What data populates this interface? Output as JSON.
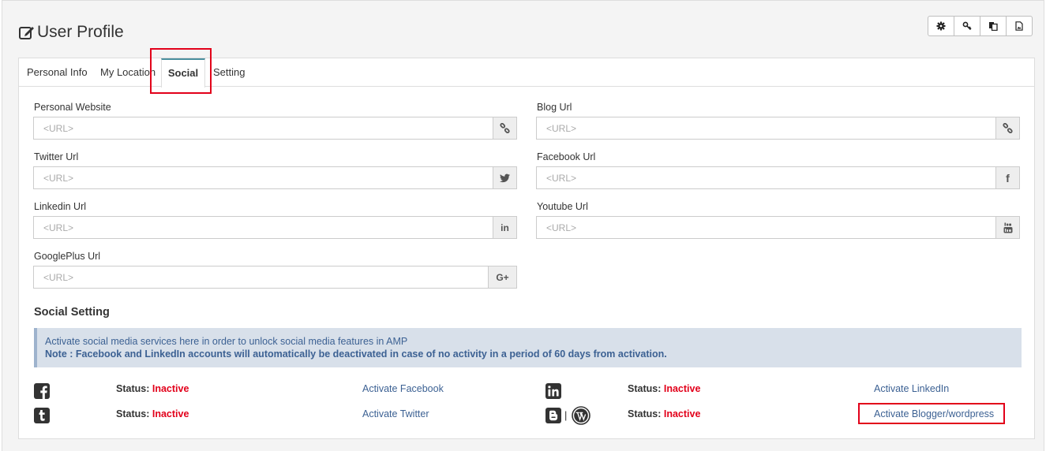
{
  "page": {
    "title": "User Profile"
  },
  "toolbar": {
    "icons": [
      "gear-icon",
      "key-icon",
      "copy-icon",
      "image-file-icon"
    ]
  },
  "tabs": [
    {
      "label": "Personal Info",
      "active": false
    },
    {
      "label": "My Location",
      "active": false
    },
    {
      "label": "Social",
      "active": true
    },
    {
      "label": "Setting",
      "active": false
    }
  ],
  "fields": {
    "personal_website": {
      "label": "Personal Website",
      "placeholder": "<URL>",
      "value": "",
      "icon": "link-icon"
    },
    "blog_url": {
      "label": "Blog Url",
      "placeholder": "<URL>",
      "value": "",
      "icon": "link-icon"
    },
    "twitter_url": {
      "label": "Twitter Url",
      "placeholder": "<URL>",
      "value": "",
      "icon": "twitter-icon"
    },
    "facebook_url": {
      "label": "Facebook Url",
      "placeholder": "<URL>",
      "value": "",
      "icon": "facebook-icon",
      "glyph": "f"
    },
    "linkedin_url": {
      "label": "Linkedin Url",
      "placeholder": "<URL>",
      "value": "",
      "icon": "linkedin-icon",
      "glyph": "in"
    },
    "youtube_url": {
      "label": "Youtube Url",
      "placeholder": "<URL>",
      "value": "",
      "icon": "youtube-icon"
    },
    "googleplus_url": {
      "label": "GooglePlus Url",
      "placeholder": "<URL>",
      "value": "",
      "icon": "google-plus-icon",
      "glyph": "G+"
    }
  },
  "social_setting": {
    "title": "Social Setting",
    "info_line": "Activate social media services here in order to unlock social media features in AMP",
    "note": "Note : Facebook and LinkedIn accounts will automatically be deactivated in case of no activity in a period of 60 days from activation.",
    "services": {
      "facebook": {
        "icon": "facebook-square-icon",
        "status_label": "Status:",
        "status_value": "Inactive",
        "action": "Activate Facebook"
      },
      "linkedin": {
        "icon": "linkedin-square-icon",
        "status_label": "Status:",
        "status_value": "Inactive",
        "action": "Activate LinkedIn"
      },
      "twitter": {
        "icon": "tumblr-square-icon",
        "status_label": "Status:",
        "status_value": "Inactive",
        "action": "Activate Twitter"
      },
      "blogger": {
        "icons": [
          "blogger-icon",
          "wordpress-icon"
        ],
        "separator": "|",
        "status_label": "Status:",
        "status_value": "Inactive",
        "action": "Activate Blogger/wordpress"
      }
    }
  },
  "colors": {
    "accent": "#4a8f9e",
    "highlight": "#e2001a",
    "inactive": "#e2001a",
    "link": "#3c6193",
    "info_bg": "#d8e0ea"
  }
}
